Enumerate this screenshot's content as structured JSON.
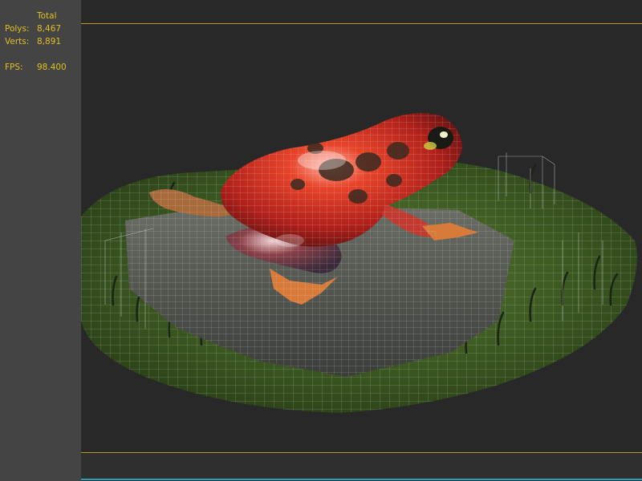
{
  "stats": {
    "header": "Total",
    "polys_label": "Polys:",
    "polys_value": "8,467",
    "verts_label": "Verts:",
    "verts_value": "8,891",
    "fps_label": "FPS:",
    "fps_value": "98.400"
  },
  "colors": {
    "stats_text": "#e0c020",
    "safe_frame": "#b89a2e",
    "bottom_accent": "#2aa0b8",
    "panel_bg": "#444444",
    "viewport_bg": "#282828"
  }
}
